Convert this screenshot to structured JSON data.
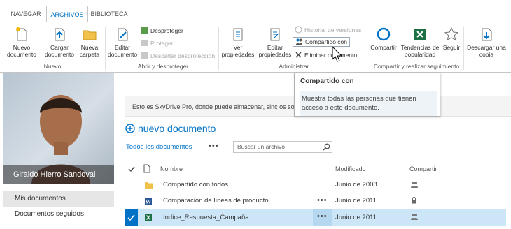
{
  "tabs": [
    {
      "label": "NAVEGAR"
    },
    {
      "label": "ARCHIVOS"
    },
    {
      "label": "BIBLIOTECA"
    }
  ],
  "ribbon": {
    "nuevo_documento": "Nuevo documento",
    "cargar_documento": "Cargar documento",
    "nueva_carpeta": "Nueva carpeta",
    "group_nuevo": "Nuevo",
    "editar_documento": "Editar documento",
    "desproteger": "Desproteger",
    "proteger": "Proteger",
    "descartar": "Descartar desprotección",
    "group_abrir": "Abrir y desproteger",
    "ver_propiedades": "Ver propiedades",
    "editar_propiedades": "Editar propiedades",
    "historial": "Historial de versiones",
    "compartido_con": "Compartido con",
    "eliminar": "Eliminar documento",
    "group_administrar": "Administrar",
    "compartir": "Compartir",
    "tendencias": "Tendencias de popularidad",
    "seguir": "Seguir",
    "group_compartir": "Compartir y realizar seguimiento",
    "descargar": "Descargar una copia"
  },
  "profile": {
    "name": "Giraldo Hierro Sandoval"
  },
  "nav": {
    "mis_documentos": "Mis documentos",
    "documentos_seguidos": "Documentos seguidos"
  },
  "banner": {
    "text": "Esto es SkyDrive Pro, donde puede almacenar, sinc                                                                                          os son privados has"
  },
  "tooltip": {
    "title": "Compartido con",
    "body": "Muestra todas las personas que tienen acceso a este documento."
  },
  "main": {
    "new_document": "nuevo documento",
    "all_documents": "Todos los documentos",
    "more": "•••",
    "search_placeholder": "Buscar un archivo"
  },
  "columns": {
    "name": "Nombre",
    "modified": "Modificado",
    "share": "Compartir"
  },
  "rows": [
    {
      "name": "Compartido con todos",
      "modified": "Junio de 2008",
      "share_icon": "people-icon",
      "type": "folder"
    },
    {
      "name": "Comparación de líneas de producto ...",
      "modified": "Junio de 2011",
      "share_icon": "lock-icon",
      "type": "word"
    },
    {
      "name": "Índice_Respuesta_Campaña",
      "modified": "Junio de 2011",
      "share_icon": "people-icon",
      "type": "excel",
      "selected": true
    }
  ],
  "colors": {
    "accent": "#0072c6",
    "selected_row": "#cde6f7"
  }
}
